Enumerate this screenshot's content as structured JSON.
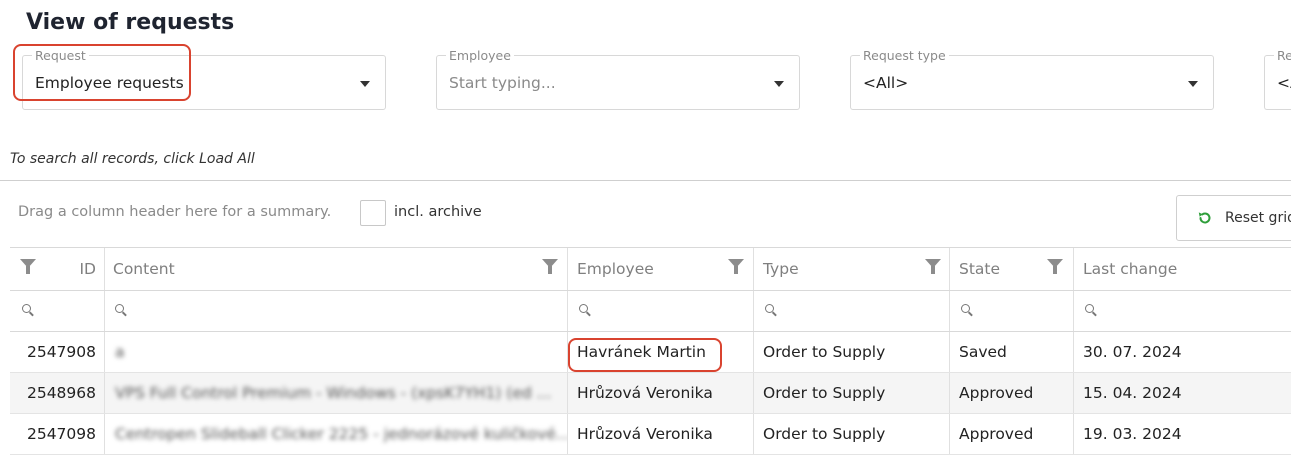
{
  "page": {
    "title": "View of requests"
  },
  "filters": {
    "request": {
      "label": "Request",
      "value": "Employee requests"
    },
    "employee": {
      "label": "Employee",
      "placeholder": "Start typing..."
    },
    "request_type": {
      "label": "Request type",
      "value": "<All>"
    },
    "fourth": {
      "label": "Re",
      "value": "<A"
    }
  },
  "hint": "To search all records, click Load All",
  "toolbar": {
    "group_hint": "Drag a column header here for a summary.",
    "archive_label": "incl. archive",
    "reset_label": "Reset grid"
  },
  "grid": {
    "columns": [
      "ID",
      "Content",
      "Employee",
      "Type",
      "State",
      "Last change"
    ],
    "rows": [
      {
        "id": "2547908",
        "content": "a",
        "employee": "Havránek Martin",
        "type": "Order to Supply",
        "state": "Saved",
        "last_change": "30. 07. 2024"
      },
      {
        "id": "2548968",
        "content": "VPS Full Control Premium - Windows - (xpsK7YH1) (ed ...",
        "employee": "Hrůzová Veronika",
        "type": "Order to Supply",
        "state": "Approved",
        "last_change": "15. 04. 2024"
      },
      {
        "id": "2547098",
        "content": "Centropen Slideball Clicker 2225 - jednorázové kuličkové...",
        "employee": "Hrůzová Veronika",
        "type": "Order to Supply",
        "state": "Approved",
        "last_change": "19. 03. 2024"
      }
    ]
  },
  "colors": {
    "highlight": "#d9432f",
    "text": "#222222",
    "muted": "#8a8a8a",
    "reset_icon": "#2e9e3a"
  }
}
